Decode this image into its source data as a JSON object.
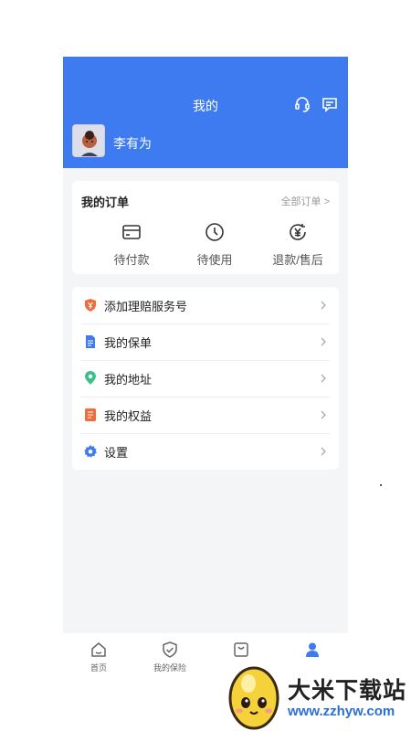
{
  "header": {
    "title": "我的",
    "user_name": "李有为",
    "bg_color": "#3e7bf0"
  },
  "orders": {
    "title": "我的订单",
    "all_link": "全部订单 >",
    "items": [
      {
        "label": "待付款",
        "icon": "card-icon"
      },
      {
        "label": "待使用",
        "icon": "clock-icon"
      },
      {
        "label": "退款/售后",
        "icon": "refund-yen-icon"
      }
    ]
  },
  "menu": {
    "items": [
      {
        "label": "添加理赔服务号",
        "icon": "shield-yen-icon",
        "color": "#f26b3a"
      },
      {
        "label": "我的保单",
        "icon": "policy-document-icon",
        "color": "#3e7bf0"
      },
      {
        "label": "我的地址",
        "icon": "location-pin-icon",
        "color": "#3cc08a"
      },
      {
        "label": "我的权益",
        "icon": "benefits-icon",
        "color": "#f26b3a"
      },
      {
        "label": "设置",
        "icon": "gear-icon",
        "color": "#3e7bf0"
      }
    ]
  },
  "tabbar": {
    "items": [
      {
        "label": "首页",
        "icon": "home-icon",
        "active": false
      },
      {
        "label": "我的保险",
        "icon": "shield-check-icon",
        "active": false
      },
      {
        "label": "",
        "icon": "bag-icon",
        "active": false
      },
      {
        "label": "",
        "icon": "user-icon",
        "active": true
      }
    ],
    "active_color": "#3e7bf0"
  },
  "watermark": {
    "name": "大米下载站",
    "url": "www.zzhyw.com"
  }
}
